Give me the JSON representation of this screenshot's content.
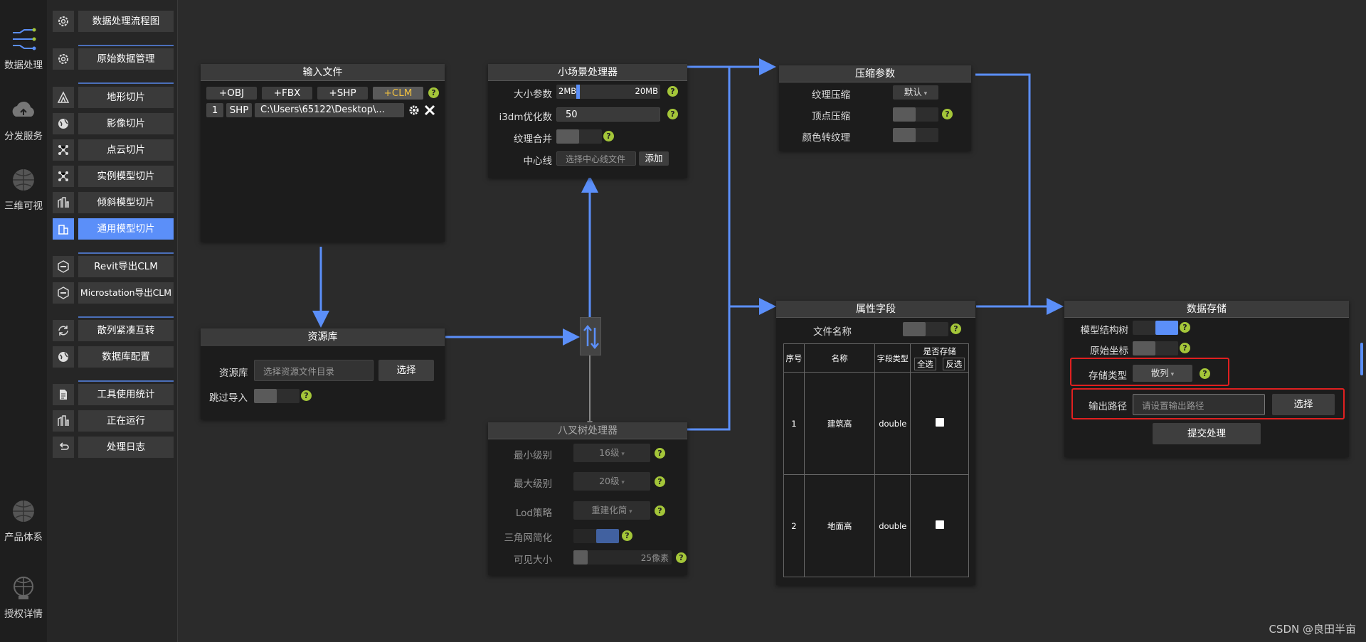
{
  "rail": [
    {
      "label": "数据处理",
      "icon": "flow-icon"
    },
    {
      "label": "分发服务",
      "icon": "cloud-icon"
    },
    {
      "label": "三维可视",
      "icon": "globe-icon"
    },
    {
      "label": "产品体系",
      "icon": "globe-icon"
    },
    {
      "label": "授权详情",
      "icon": "license-icon"
    }
  ],
  "menu": [
    {
      "label": "数据处理流程图"
    },
    {
      "label": "原始数据管理"
    },
    {
      "label": "地形切片"
    },
    {
      "label": "影像切片"
    },
    {
      "label": "点云切片"
    },
    {
      "label": "实例模型切片"
    },
    {
      "label": "倾斜模型切片"
    },
    {
      "label": "通用模型切片"
    },
    {
      "label": "Revit导出CLM"
    },
    {
      "label": "Microstation导出CLM"
    },
    {
      "label": "散列紧凑互转"
    },
    {
      "label": "数据库配置"
    },
    {
      "label": "工具使用统计"
    },
    {
      "label": "正在运行"
    },
    {
      "label": "处理日志"
    }
  ],
  "input_files": {
    "title": "输入文件",
    "buttons": [
      "+OBJ",
      "+FBX",
      "+SHP",
      "+CLM"
    ],
    "row": {
      "index": "1",
      "type": "SHP",
      "path": "C:\\Users\\65122\\Desktop\\..."
    }
  },
  "resource": {
    "title": "资源库",
    "label": "资源库",
    "placeholder": "选择资源文件目录",
    "choose": "选择",
    "skip_label": "跳过导入"
  },
  "small_scene": {
    "title": "小场景处理器",
    "size_label": "大小参数",
    "size_min": "2MB",
    "size_max": "20MB",
    "i3dm_label": "i3dm优化数",
    "i3dm_value": "50",
    "texture_merge_label": "纹理合并",
    "centerline_label": "中心线",
    "centerline_placeholder": "选择中心线文件",
    "add": "添加"
  },
  "octree": {
    "title": "八叉树处理器",
    "min_level_label": "最小级别",
    "min_level": "16级",
    "max_level_label": "最大级别",
    "max_level": "20级",
    "lod_label": "Lod策略",
    "lod": "重建化简",
    "tri_label": "三角网简化",
    "visible_label": "可见大小",
    "visible_value": "25像素"
  },
  "compress": {
    "title": "压缩参数",
    "tex_label": "纹理压缩",
    "tex_value": "默认",
    "vertex_label": "顶点压缩",
    "color_label": "颜色转纹理"
  },
  "attrs": {
    "title": "属性字段",
    "filename_label": "文件名称",
    "headers": [
      "序号",
      "名称",
      "字段类型",
      "是否存储"
    ],
    "select_all": "全选",
    "invert": "反选",
    "rows": [
      {
        "idx": "1",
        "name": "建筑高",
        "type": "double"
      },
      {
        "idx": "2",
        "name": "地面高",
        "type": "double"
      }
    ]
  },
  "storage": {
    "title": "数据存储",
    "tree_label": "模型结构树",
    "origin_label": "原始坐标",
    "type_label": "存储类型",
    "type_value": "散列",
    "out_label": "输出路径",
    "out_placeholder": "请设置输出路径",
    "choose": "选择",
    "submit": "提交处理"
  },
  "help_glyph": "?",
  "watermark": "CSDN @良田半亩",
  "colors": {
    "accent": "#5b8ff9",
    "help": "#a4c639",
    "highlight": "#e02020",
    "clm": "#f0c040"
  }
}
